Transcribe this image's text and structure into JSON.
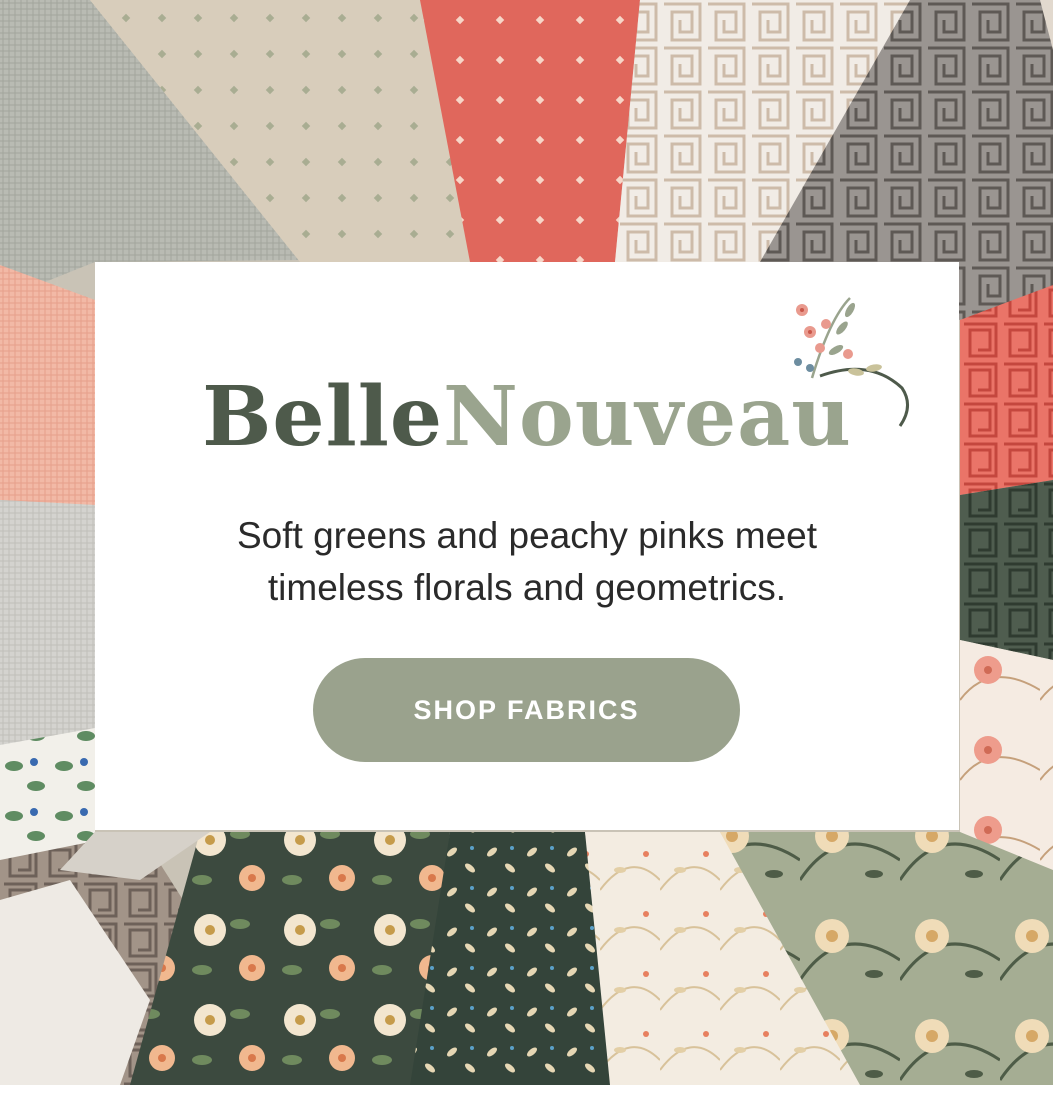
{
  "banner": {
    "logo_part1": "Belle",
    "logo_part2": "Nouveau",
    "tagline_line1": "Soft greens and peachy pinks meet",
    "tagline_line2": "timeless florals and geometrics.",
    "cta_label": "SHOP FABRICS"
  },
  "colors": {
    "panel_bg": "#ffffff",
    "logo_dark": "#4e5a4b",
    "logo_light": "#9aa48e",
    "button_bg": "#9aa28d",
    "button_text": "#ffffff",
    "coral": "#e0675c",
    "sage": "#a4ac92",
    "forest": "#3e4d40",
    "linen": "#d9cfbf"
  }
}
